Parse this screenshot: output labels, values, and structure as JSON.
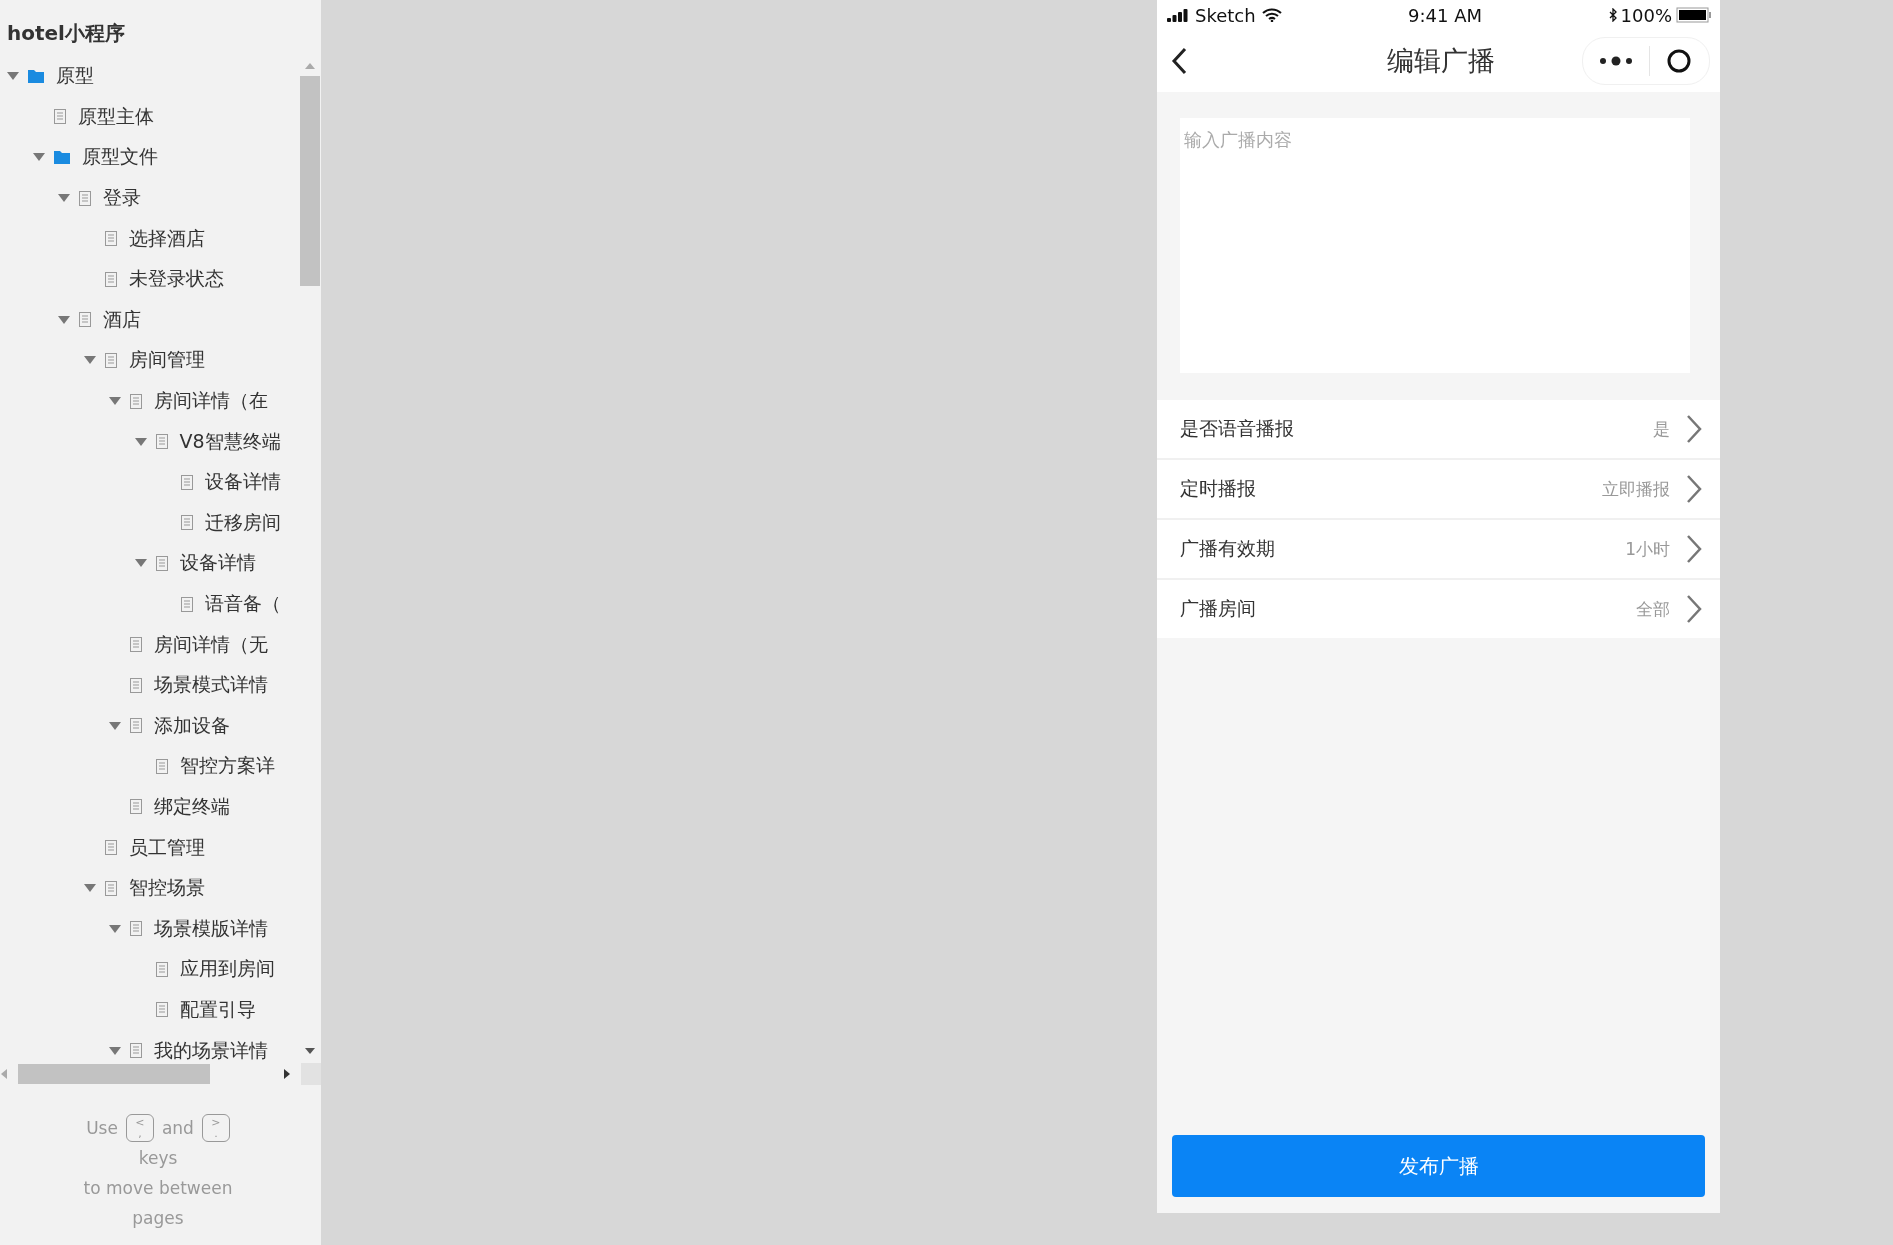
{
  "sidebar": {
    "title": "hotel小程序",
    "tree": [
      {
        "label": "原型",
        "kind": "folder",
        "expanded": true,
        "children": [
          {
            "label": "原型主体",
            "kind": "page"
          },
          {
            "label": "原型文件",
            "kind": "folder",
            "expanded": true,
            "children": [
              {
                "label": "登录",
                "kind": "page",
                "expanded": true,
                "children": [
                  {
                    "label": "选择酒店",
                    "kind": "page"
                  },
                  {
                    "label": "未登录状态",
                    "kind": "page"
                  }
                ]
              },
              {
                "label": "酒店",
                "kind": "page",
                "expanded": true,
                "children": [
                  {
                    "label": "房间管理",
                    "kind": "page",
                    "expanded": true,
                    "children": [
                      {
                        "label": "房间详情（在",
                        "kind": "page",
                        "expanded": true,
                        "children": [
                          {
                            "label": "V8智慧终端",
                            "kind": "page",
                            "expanded": true,
                            "children": [
                              {
                                "label": "设备详情",
                                "kind": "page"
                              },
                              {
                                "label": "迁移房间",
                                "kind": "page"
                              }
                            ]
                          },
                          {
                            "label": "设备详情",
                            "kind": "page",
                            "expanded": true,
                            "children": [
                              {
                                "label": "语音备（",
                                "kind": "page"
                              }
                            ]
                          }
                        ]
                      },
                      {
                        "label": "房间详情（无",
                        "kind": "page"
                      },
                      {
                        "label": "场景模式详情",
                        "kind": "page"
                      },
                      {
                        "label": "添加设备",
                        "kind": "page",
                        "expanded": true,
                        "children": [
                          {
                            "label": "智控方案详",
                            "kind": "page"
                          }
                        ]
                      },
                      {
                        "label": "绑定终端",
                        "kind": "page"
                      }
                    ]
                  },
                  {
                    "label": "员工管理",
                    "kind": "page"
                  },
                  {
                    "label": "智控场景",
                    "kind": "page",
                    "expanded": true,
                    "children": [
                      {
                        "label": "场景模版详情",
                        "kind": "page",
                        "expanded": true,
                        "children": [
                          {
                            "label": "应用到房间",
                            "kind": "page"
                          },
                          {
                            "label": "配置引导",
                            "kind": "page"
                          }
                        ]
                      },
                      {
                        "label": "我的场景详情",
                        "kind": "page",
                        "expanded": true
                      }
                    ]
                  }
                ]
              }
            ]
          }
        ]
      }
    ],
    "hint": {
      "use": "Use",
      "key_prev": {
        "top": "<",
        "bottom": ","
      },
      "and": "and",
      "key_next": {
        "top": ">",
        "bottom": "."
      },
      "keys": "keys",
      "line_2": "to move between",
      "line_3": "pages"
    }
  },
  "phone": {
    "status_bar": {
      "carrier": "Sketch",
      "time": "9:41 AM",
      "battery": "100%"
    },
    "nav": {
      "title": "编辑广播"
    },
    "content_field": {
      "placeholder": "输入广播内容"
    },
    "settings": [
      {
        "label": "是否语音播报",
        "value": "是"
      },
      {
        "label": "定时播报",
        "value": "立即播报"
      },
      {
        "label": "广播有效期",
        "value": "1小时"
      },
      {
        "label": "广播房间",
        "value": "全部"
      }
    ],
    "submit_button": "发布广播"
  }
}
